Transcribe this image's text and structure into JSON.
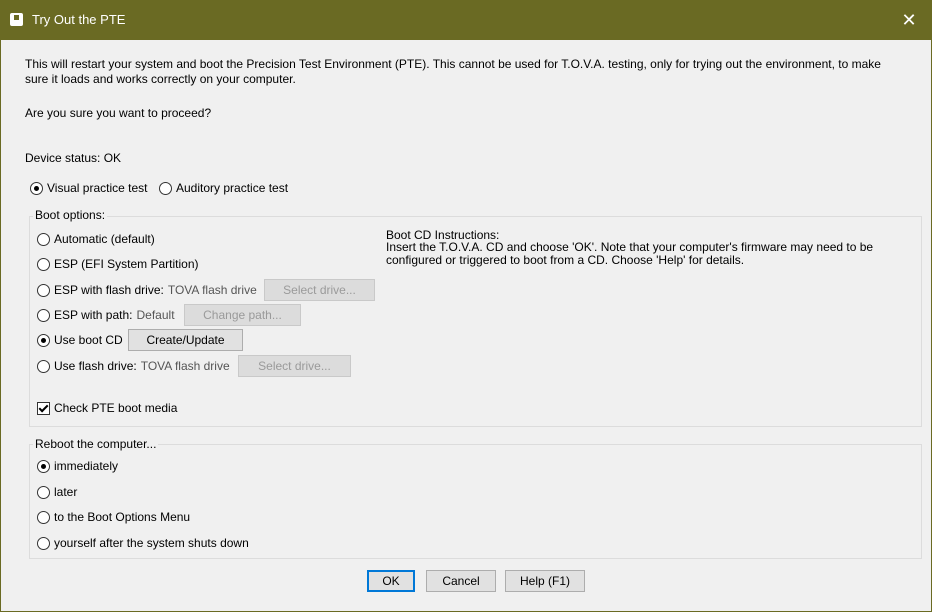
{
  "window": {
    "title": "Try Out the PTE",
    "close_glyph": "✕"
  },
  "intro": {
    "description": "This will restart your system and boot the Precision Test Environment (PTE). This cannot be used for T.O.V.A. testing, only for trying out the environment, to make sure it loads and works correctly on your computer.",
    "confirm": "Are you sure you want to proceed?",
    "device_status": "Device status: OK"
  },
  "test_type": {
    "visual": "Visual practice test",
    "auditory": "Auditory practice test",
    "selected": "visual"
  },
  "boot_options": {
    "label": "Boot options:",
    "automatic": "Automatic (default)",
    "esp": "ESP (EFI System Partition)",
    "esp_flash": "ESP with flash drive:",
    "esp_flash_value": "TOVA flash drive",
    "esp_flash_button": "Select drive...",
    "esp_path": "ESP with path:",
    "esp_path_value": "Default",
    "esp_path_button": "Change path...",
    "boot_cd": "Use boot CD",
    "boot_cd_button": "Create/Update",
    "flash_drive": "Use flash drive:",
    "flash_drive_value": "TOVA flash drive",
    "flash_drive_button": "Select drive...",
    "selected": "boot_cd",
    "check_media": "Check PTE boot media",
    "check_media_checked": true,
    "instructions_title": "Boot CD Instructions:",
    "instructions_body": "Insert the T.O.V.A. CD and choose 'OK'. Note that your computer's firmware may need to be configured or triggered to boot from a CD. Choose 'Help' for details."
  },
  "reboot": {
    "label": "Reboot the computer...",
    "immediately": "immediately",
    "later": "later",
    "boot_menu": "to the Boot Options Menu",
    "yourself": "yourself after the system shuts down",
    "selected": "immediately"
  },
  "buttons": {
    "ok": "OK",
    "cancel": "Cancel",
    "help": "Help (F1)"
  },
  "colors": {
    "titlebar": "#6a6a23",
    "dialog_bg": "#f0f0f0"
  }
}
